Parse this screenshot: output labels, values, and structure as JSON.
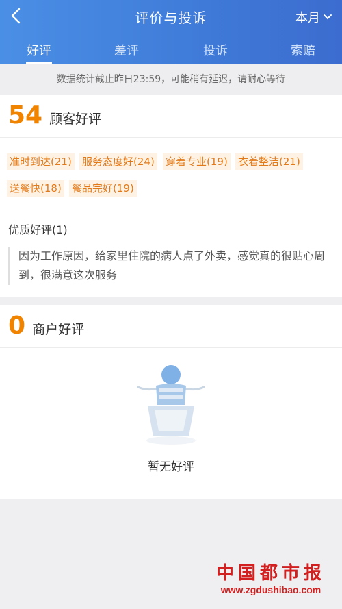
{
  "header": {
    "title": "评价与投诉",
    "period": "本月",
    "tabs": [
      {
        "label": "好评",
        "active": true
      },
      {
        "label": "差评",
        "active": false
      },
      {
        "label": "投诉",
        "active": false
      },
      {
        "label": "索赔",
        "active": false
      }
    ]
  },
  "notice": "数据统计截止昨日23:59，可能稍有延迟，请耐心等待",
  "customer_reviews": {
    "count": "54",
    "label": "顾客好评",
    "tags": [
      "准时到达(21)",
      "服务态度好(24)",
      "穿着专业(19)",
      "衣着整洁(21)",
      "送餐快(18)",
      "餐品完好(19)"
    ],
    "quality_title": "优质好评(1)",
    "quality_text": "因为工作原因，给家里住院的病人点了外卖，感觉真的很贴心周到，很满意这次服务"
  },
  "merchant_reviews": {
    "count": "0",
    "label": "商户好评",
    "empty_text": "暂无好评"
  },
  "watermark": {
    "title": "中国都市报",
    "url": "www.zgdushibao.com"
  },
  "colors": {
    "header_blue": "#4080dc",
    "accent_orange": "#f08300",
    "tag_bg": "#fdf2e4",
    "watermark_red": "#d21f1f"
  }
}
